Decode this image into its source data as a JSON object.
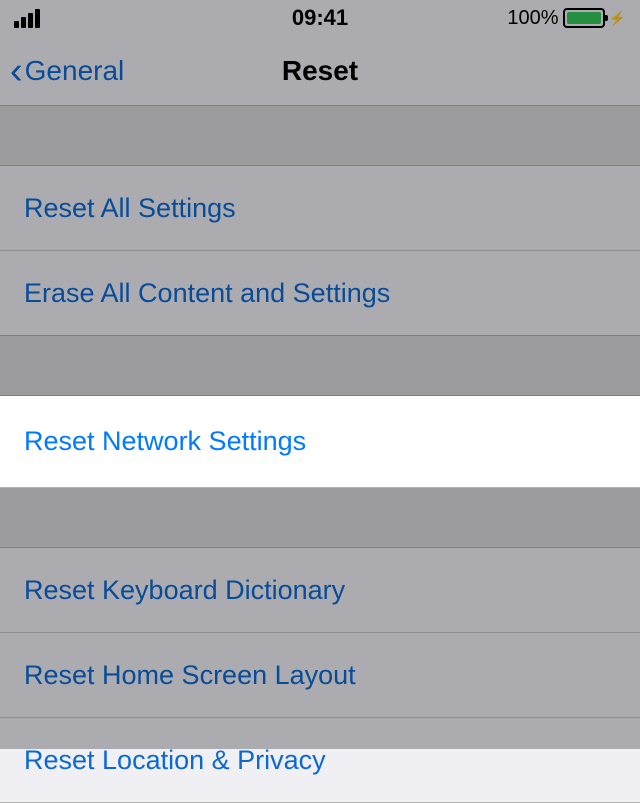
{
  "status": {
    "time": "09:41",
    "battery_pct": "100%"
  },
  "nav": {
    "back_label": "General",
    "title": "Reset"
  },
  "rows": {
    "reset_all_settings": "Reset All Settings",
    "erase_all": "Erase All Content and Settings",
    "reset_network": "Reset Network Settings",
    "reset_keyboard": "Reset Keyboard Dictionary",
    "reset_home": "Reset Home Screen Layout",
    "reset_location": "Reset Location & Privacy"
  }
}
